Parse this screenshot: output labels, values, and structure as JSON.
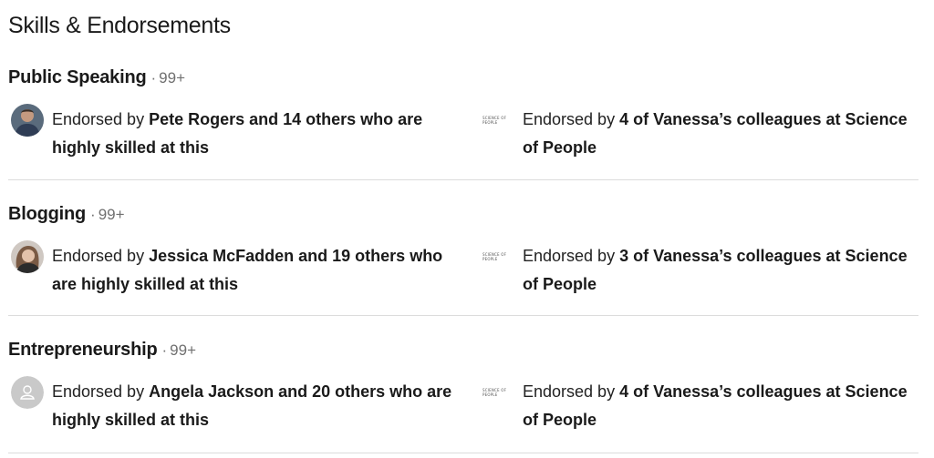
{
  "section_title": "Skills & Endorsements",
  "endorsed_by_prefix": "Endorsed by ",
  "skills": [
    {
      "name": "Public Speaking",
      "separator": "·",
      "count": "99+",
      "left": {
        "highlight": "Pete Rogers and 14 others who are highly skilled at this",
        "avatar_icon": "person-photo-icon"
      },
      "right": {
        "highlight": "4 of Vanessa’s colleagues at Science of People",
        "logo_text": "SCIENCE OF PEOPLE"
      }
    },
    {
      "name": "Blogging",
      "separator": "·",
      "count": "99+",
      "left": {
        "highlight": "Jessica McFadden and 19 others who are highly skilled at this",
        "avatar_icon": "person-photo-icon"
      },
      "right": {
        "highlight": "3 of Vanessa’s colleagues at Science of People",
        "logo_text": "SCIENCE OF PEOPLE"
      }
    },
    {
      "name": "Entrepreneurship",
      "separator": "·",
      "count": "99+",
      "left": {
        "highlight": "Angela Jackson and 20 others who are highly skilled at this",
        "avatar_icon": "default-avatar-icon"
      },
      "right": {
        "highlight": "4 of Vanessa’s colleagues at Science of People",
        "logo_text": "SCIENCE OF PEOPLE"
      }
    }
  ]
}
